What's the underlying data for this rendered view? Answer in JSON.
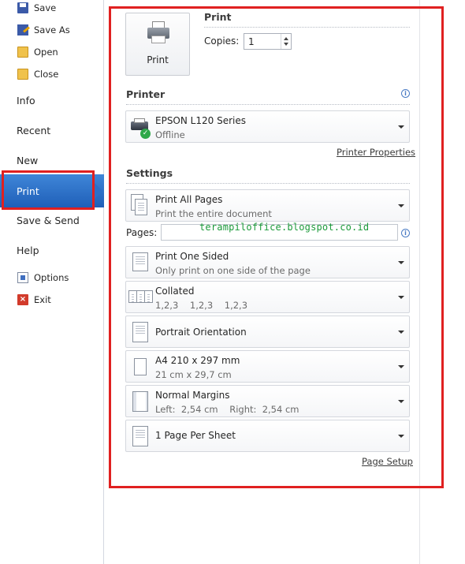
{
  "nav": {
    "save": "Save",
    "save_as": "Save As",
    "open": "Open",
    "close": "Close",
    "info": "Info",
    "recent": "Recent",
    "new": "New",
    "print": "Print",
    "save_send": "Save & Send",
    "help": "Help",
    "options": "Options",
    "exit": "Exit"
  },
  "print": {
    "section_title": "Print",
    "button_label": "Print",
    "copies_label": "Copies:",
    "copies_value": "1"
  },
  "printer": {
    "section_title": "Printer",
    "name": "EPSON L120 Series",
    "status": "Offline",
    "properties_link": "Printer Properties"
  },
  "settings": {
    "section_title": "Settings",
    "pages_label": "Pages:",
    "watermark": "terampiloffice.blogspot.co.id",
    "items": [
      {
        "title": "Print All Pages",
        "subtitle": "Print the entire document"
      },
      {
        "title": "Print One Sided",
        "subtitle": "Only print on one side of the page"
      },
      {
        "title": "Collated",
        "subtitle": "1,2,3    1,2,3    1,2,3"
      },
      {
        "title": "Portrait Orientation",
        "subtitle": ""
      },
      {
        "title": "A4 210 x 297 mm",
        "subtitle": "21 cm x 29,7 cm"
      },
      {
        "title": "Normal Margins",
        "subtitle": "Left:  2,54 cm    Right:  2,54 cm"
      },
      {
        "title": "1 Page Per Sheet",
        "subtitle": ""
      }
    ],
    "page_setup_link": "Page Setup"
  },
  "colors": {
    "accent_blue": "#2c6fc8",
    "highlight_red": "#e02020",
    "watermark_green": "#1c9a3a"
  }
}
